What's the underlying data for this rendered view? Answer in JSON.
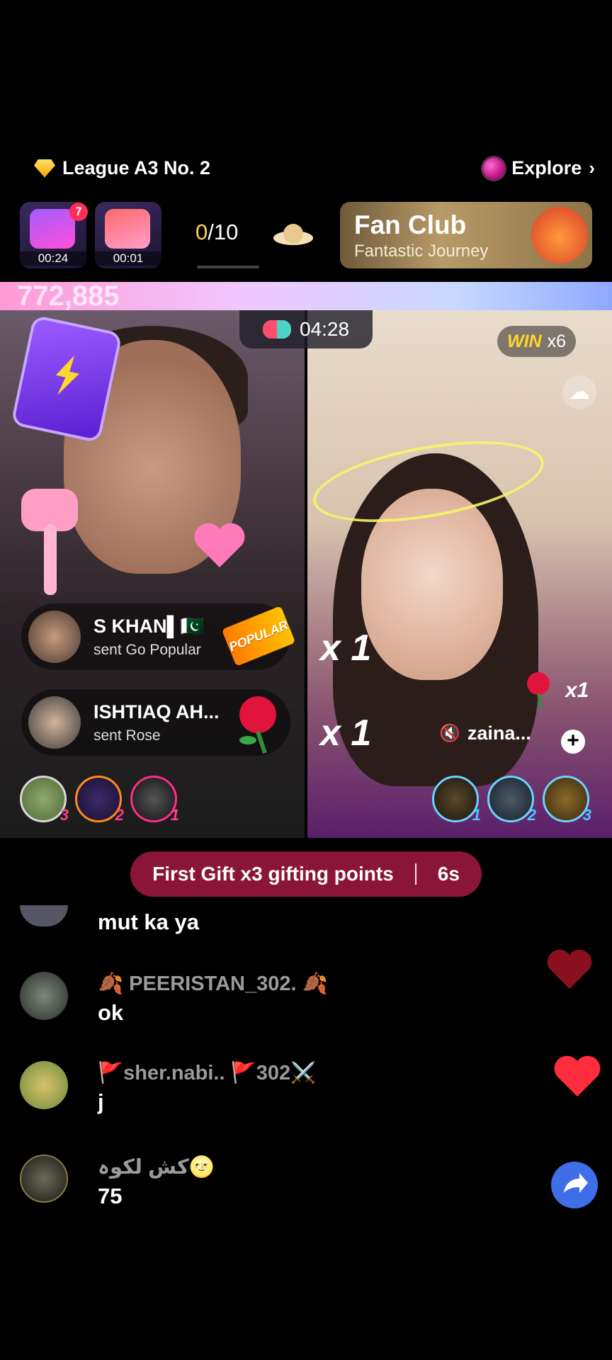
{
  "header": {
    "league": "League A3 No. 2",
    "explore": "Explore"
  },
  "tasks": [
    {
      "time": "00:24",
      "badge": "7"
    },
    {
      "time": "00:01"
    }
  ],
  "progress": {
    "current": "0",
    "total": "/10"
  },
  "fan_club": {
    "title": "Fan Club",
    "subtitle": "Fantastic Journey"
  },
  "battle": {
    "score_left": "772,885",
    "timer": "04:28",
    "win_label": "WIN",
    "win_count": "x6"
  },
  "gifts": [
    {
      "user": "S KHAN▌🇵🇰",
      "action": "sent Go Popular",
      "sticker": "POPULAR",
      "combo": "x 1"
    },
    {
      "user": "ISHTIAQ AH...",
      "action": "sent Rose",
      "combo": "x 1"
    }
  ],
  "right_gift": {
    "count": "x1"
  },
  "guest": {
    "name": "zaina...",
    "mute_icon": "🔇"
  },
  "rank_left": [
    "3",
    "2",
    "1"
  ],
  "rank_right": [
    "1",
    "2",
    "3"
  ],
  "first_gift": {
    "text": "First Gift x3 gifting points",
    "countdown": "6s"
  },
  "chat": [
    {
      "user": "",
      "message": "mut ka ya"
    },
    {
      "user": "🍂 PEERISTAN_302. 🍂",
      "message": "ok"
    },
    {
      "user": "🚩sher.nabi.. 🚩302⚔️",
      "message": "j"
    },
    {
      "user": "کش لکوہ🌝",
      "message": "75"
    }
  ],
  "colors": {
    "first_gift_bg": "#8b1538",
    "share_btn": "#3f6fe8",
    "heart_red": "#ff2d3d",
    "win_yellow": "#ffd52e"
  }
}
